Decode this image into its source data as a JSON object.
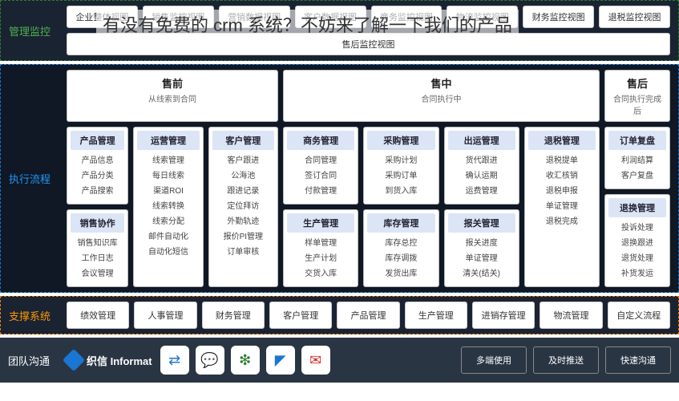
{
  "overlay_text": "有没有免费的 crm 系统？不妨来了解一下我们的产品",
  "s1": {
    "label": "管理监控",
    "items": [
      "企业整体视图",
      "销售监控视图",
      "营销数据视图",
      "客户数据视图",
      "商务监控视图",
      "物流监控视图",
      "财务监控视图",
      "退税监控视图",
      "售后监控视图"
    ]
  },
  "s2": {
    "label": "执行流程",
    "phases": [
      {
        "title": "售前",
        "sub": "从线索到合同"
      },
      {
        "title": "售中",
        "sub": "合同执行中"
      },
      {
        "title": "售后",
        "sub": "合同执行完成后"
      }
    ],
    "group1": [
      {
        "head": "产品管理",
        "items": [
          "产品信息",
          "产品分类",
          "产品搜索"
        ]
      },
      {
        "head": "销售协作",
        "items": [
          "销售知识库",
          "工作日志",
          "会议管理"
        ]
      },
      {
        "head": "运营管理",
        "items": [
          "线索管理",
          "每日线索",
          "渠道ROI",
          "线索转换",
          "线索分配",
          "邮件自动化",
          "自动化短信"
        ]
      },
      {
        "head": "客户管理",
        "items": [
          "客户跟进",
          "公海池",
          "跟进记录",
          "定位拜访",
          "外勤轨迹",
          "报价PI管理",
          "订单审核"
        ]
      }
    ],
    "group2": [
      {
        "head": "商务管理",
        "items": [
          "合同管理",
          "签订合同",
          "付款管理"
        ]
      },
      {
        "head": "生产管理",
        "items": [
          "样单管理",
          "生产计划",
          "交货入库"
        ]
      },
      {
        "head": "采购管理",
        "items": [
          "采购计划",
          "采购订单",
          "到货入库"
        ]
      },
      {
        "head": "库存管理",
        "items": [
          "库存总控",
          "库存调拨",
          "发货出库"
        ]
      },
      {
        "head": "出运管理",
        "items": [
          "货代跟进",
          "确认运期",
          "运费管理"
        ]
      },
      {
        "head": "报关管理",
        "items": [
          "报关进度",
          "单证管理",
          "清关(结关)"
        ]
      },
      {
        "head": "退税管理",
        "items": [
          "退税提单",
          "收汇核销",
          "退税申报",
          "单证管理",
          "退税完成"
        ]
      }
    ],
    "group3": [
      {
        "head": "订单复盘",
        "items": [
          "利润结算",
          "客户复盘"
        ]
      },
      {
        "head": "退换管理",
        "items": [
          "投诉处理",
          "退换跟进",
          "退货处理",
          "补货发运"
        ]
      }
    ]
  },
  "s3": {
    "label": "支撑系统",
    "items": [
      "绩效管理",
      "人事管理",
      "财务管理",
      "客户管理",
      "产品管理",
      "生产管理",
      "进销存管理",
      "物流管理",
      "自定义流程"
    ]
  },
  "s4": {
    "label": "团队沟通",
    "brand": "织信 Informat",
    "icons": [
      "swap-icon",
      "chat-icon",
      "wechat-icon",
      "dingtalk-icon",
      "mail-icon"
    ],
    "buttons": [
      "多端使用",
      "及时推送",
      "快速沟通"
    ]
  }
}
